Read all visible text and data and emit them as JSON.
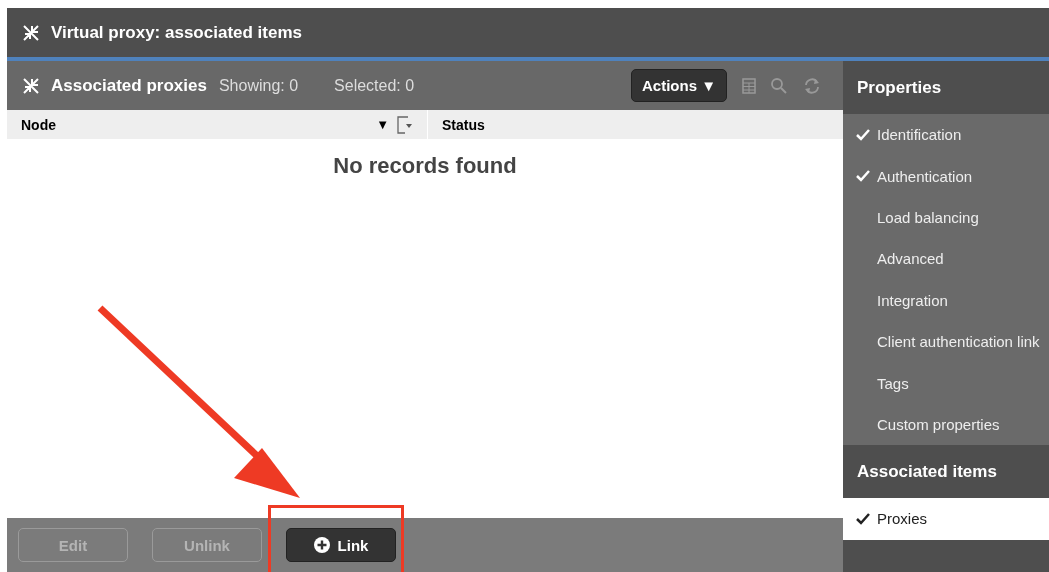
{
  "window": {
    "title": "Virtual proxy: associated items"
  },
  "panel": {
    "title": "Associated proxies",
    "showing": "Showing: 0",
    "selected": "Selected: 0",
    "actions": "Actions ▼"
  },
  "table": {
    "columns": [
      {
        "label": "Node",
        "sort": "▼"
      },
      {
        "label": "Status"
      }
    ],
    "empty_message": "No records found"
  },
  "footer_buttons": [
    {
      "label": "Edit",
      "disabled": true,
      "kind": "plain"
    },
    {
      "label": "Unlink",
      "disabled": true,
      "kind": "plain"
    },
    {
      "label": "Link",
      "disabled": false,
      "kind": "add"
    }
  ],
  "sidebar": {
    "sections": [
      {
        "title": "Properties",
        "items": [
          {
            "label": "Identification",
            "checked": true,
            "selected": false
          },
          {
            "label": "Authentication",
            "checked": true,
            "selected": false
          },
          {
            "label": "Load balancing",
            "checked": false,
            "selected": false
          },
          {
            "label": "Advanced",
            "checked": false,
            "selected": false
          },
          {
            "label": "Integration",
            "checked": false,
            "selected": false
          },
          {
            "label": "Client authentication link",
            "checked": false,
            "selected": false
          },
          {
            "label": "Tags",
            "checked": false,
            "selected": false
          },
          {
            "label": "Custom properties",
            "checked": false,
            "selected": false
          }
        ]
      },
      {
        "title": "Associated items",
        "items": [
          {
            "label": "Proxies",
            "checked": true,
            "selected": true
          }
        ]
      }
    ]
  }
}
